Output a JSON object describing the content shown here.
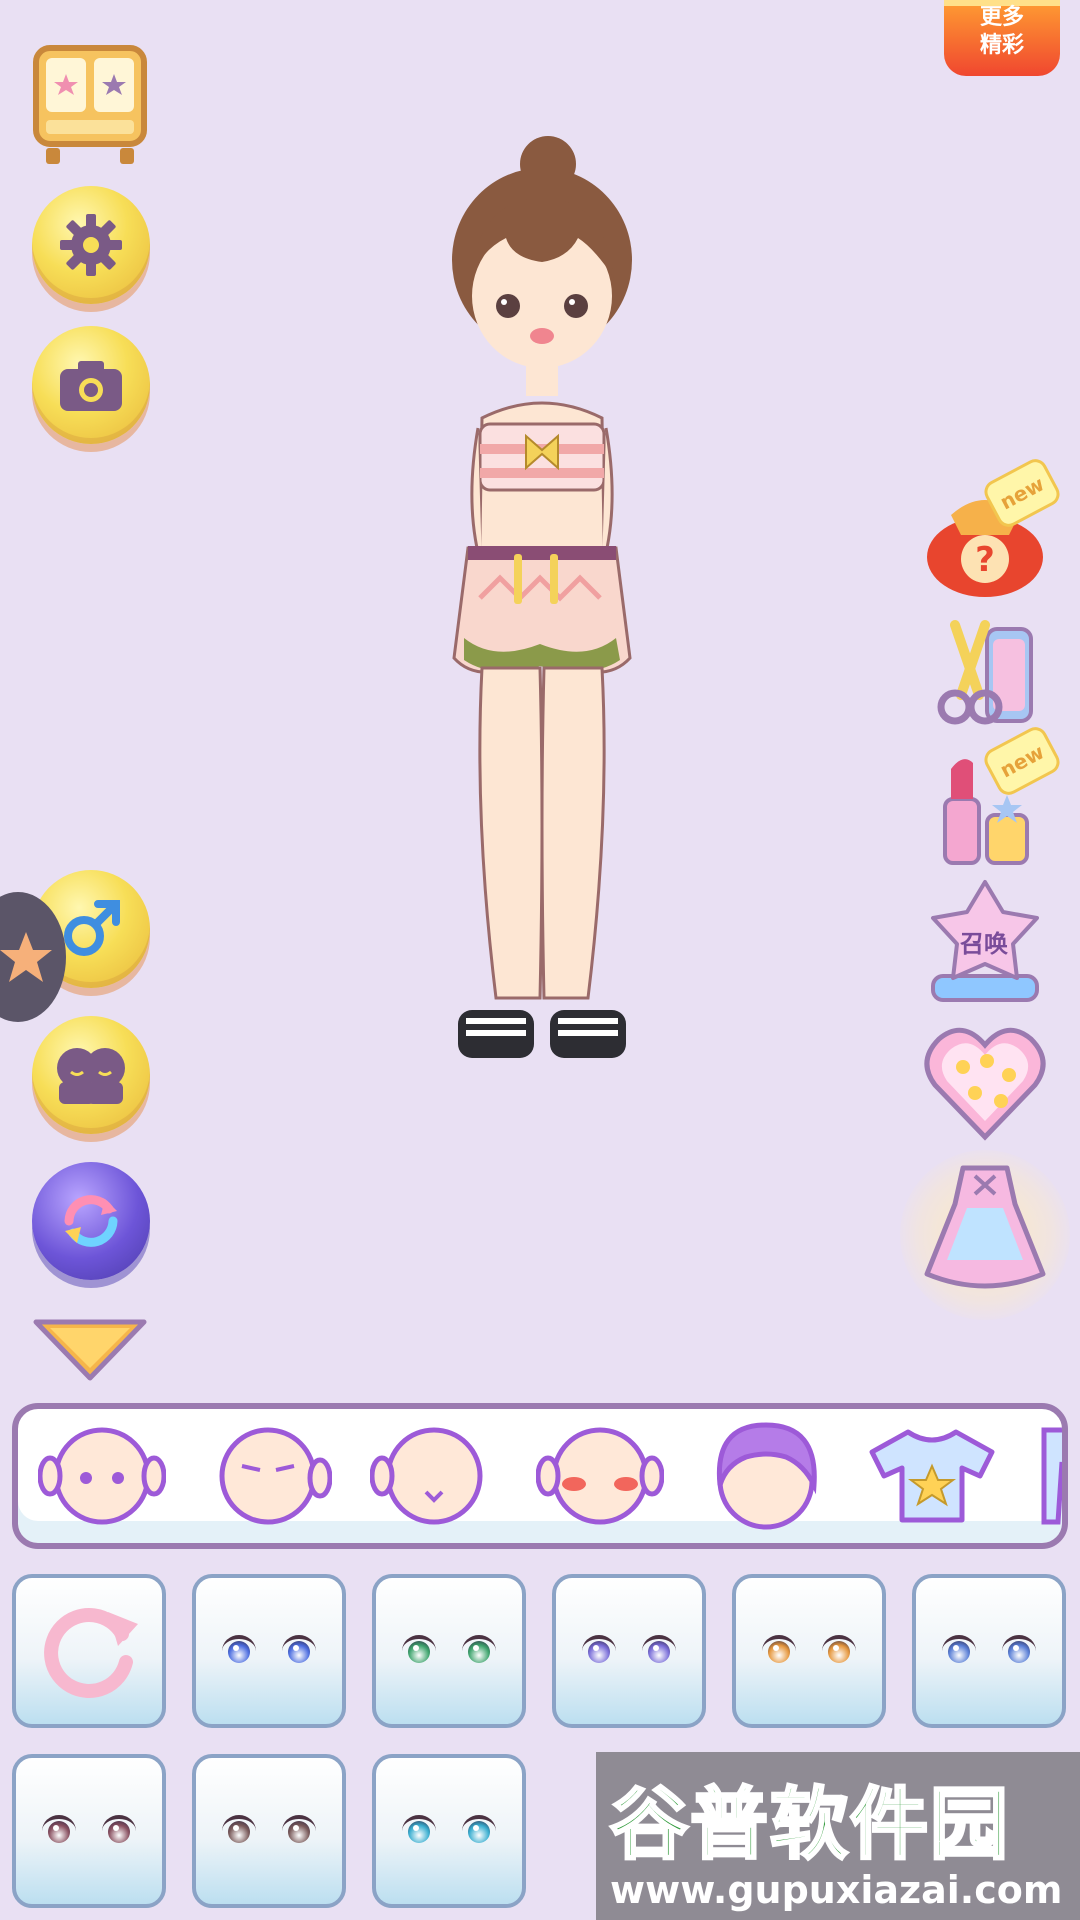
{
  "top_badge": {
    "line1": "更多",
    "line2": "精彩"
  },
  "left_toolbar": {
    "icons": [
      "wardrobe-icon",
      "gear-icon",
      "camera-icon",
      "male-gender-icon",
      "couple-icon",
      "swap-icon",
      "chevron-down-icon"
    ]
  },
  "right_toolbar": {
    "items": [
      {
        "icon": "lucky-bag-icon",
        "badge": "new"
      },
      {
        "icon": "scissors-icon",
        "badge": ""
      },
      {
        "icon": "lipstick-icon",
        "badge": "new"
      },
      {
        "icon": "summon-star-icon",
        "label": "召唤"
      },
      {
        "icon": "star-heart-icon"
      },
      {
        "icon": "dress-icon"
      }
    ]
  },
  "categories": [
    "face-dots-icon",
    "face-brows-icon",
    "face-mouth-icon",
    "face-blush-icon",
    "hair-icon",
    "shirt-star-icon",
    "pants-icon"
  ],
  "eye_tiles": [
    {
      "type": "reset",
      "icon": "reset-icon"
    },
    {
      "type": "eye",
      "color": "#4d6ee0"
    },
    {
      "type": "eye",
      "color": "#3fa56e"
    },
    {
      "type": "eye",
      "color": "#7b6fd9"
    },
    {
      "type": "eye",
      "color": "#e6983f"
    },
    {
      "type": "eye",
      "color": "#5a7fd6"
    },
    {
      "type": "eye",
      "color": "#8a5262"
    },
    {
      "type": "eye",
      "color": "#7a5b5b"
    },
    {
      "type": "eye",
      "color": "#3aaed0"
    }
  ],
  "watermark": {
    "title": "谷普软件园",
    "url": "www.gupuxiazai.com"
  }
}
